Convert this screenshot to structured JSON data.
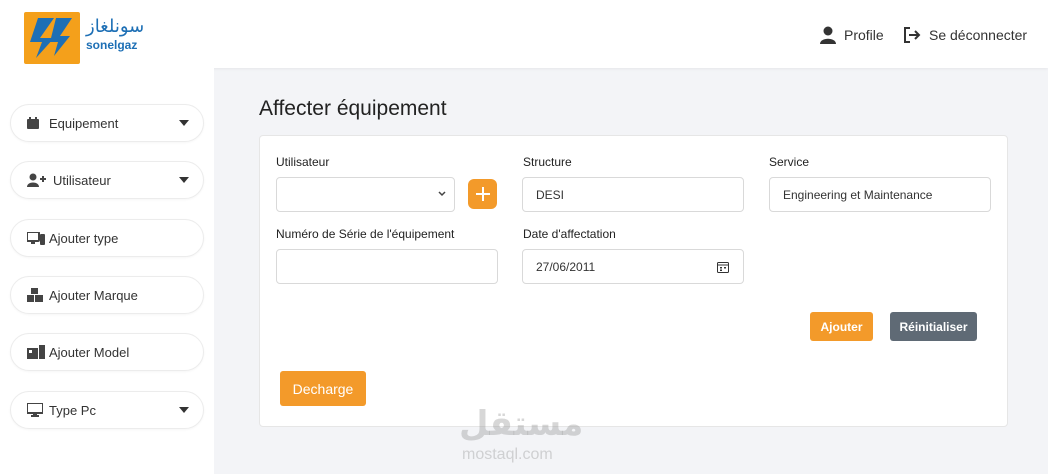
{
  "header": {
    "logo_arabic": "سونلغاز",
    "logo_latin": "sonelgaz",
    "profile_label": "Profile",
    "logout_label": "Se déconnecter"
  },
  "sidebar": {
    "items": [
      {
        "label": "Equipement",
        "icon": "calendar-icon",
        "has_caret": true
      },
      {
        "label": "Utilisateur",
        "icon": "user-plus-icon",
        "has_caret": true
      },
      {
        "label": "Ajouter type",
        "icon": "devices-icon",
        "has_caret": false
      },
      {
        "label": "Ajouter Marque",
        "icon": "boxes-icon",
        "has_caret": false
      },
      {
        "label": "Ajouter Model",
        "icon": "model-icon",
        "has_caret": false
      },
      {
        "label": "Type Pc",
        "icon": "desktop-icon",
        "has_caret": true
      }
    ]
  },
  "form": {
    "title": "Affecter équipement",
    "utilisateur_label": "Utilisateur",
    "utilisateur_value": "",
    "structure_label": "Structure",
    "structure_value": "DESI",
    "service_label": "Service",
    "service_value": "Engineering et Maintenance",
    "serie_label": "Numéro de Série de l'équipement",
    "serie_value": "",
    "date_label": "Date d'affectation",
    "date_value": "27/06/2011",
    "ajouter_label": "Ajouter",
    "reset_label": "Réinitialiser",
    "decharge_label": "Decharge"
  },
  "watermark": {
    "arabic": "مستقل",
    "latin": "mostaql.com"
  },
  "colors": {
    "accent": "#f39a2a",
    "secondary": "#5f6a75",
    "brand_blue": "#1d6fb5"
  }
}
